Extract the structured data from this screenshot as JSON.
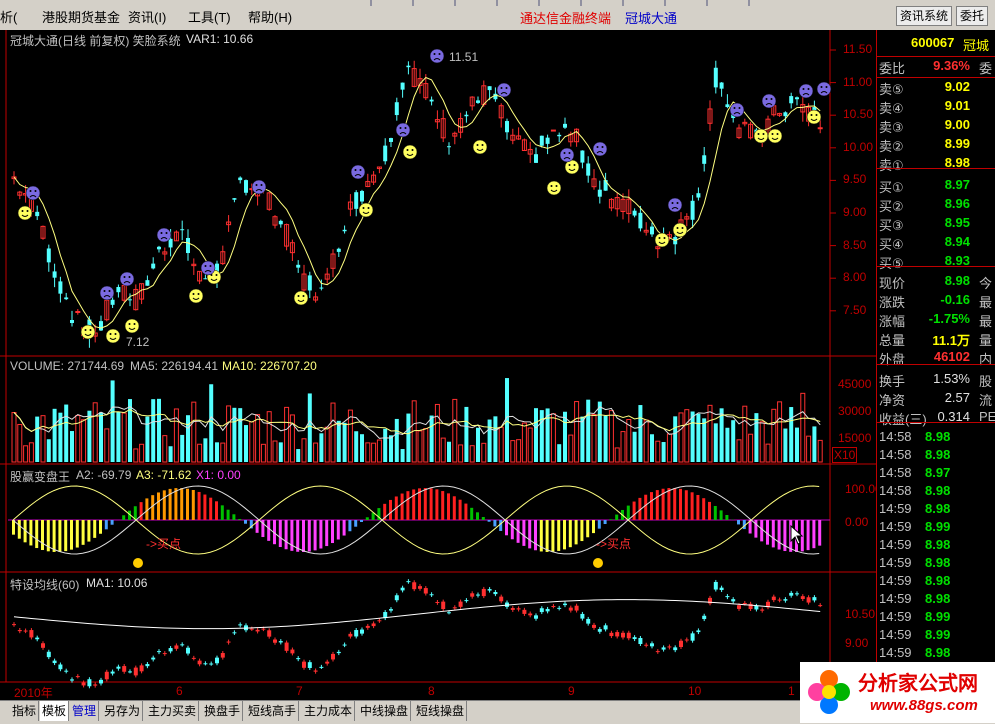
{
  "menu": {
    "items": [
      "析(",
      "港股期货基金",
      "资讯(I)",
      "工具(T)",
      "帮助(H)"
    ],
    "brand_red": "通达信金融终端",
    "brand_blue": "冠城大通",
    "btn_info": "资讯系统",
    "btn_trade": "委托"
  },
  "main_panel": {
    "title": "冠城大通(日线 前复权) 笑脸系统",
    "var_label": "VAR1: 10.66",
    "high_label": "11.51",
    "low_label": "7.12",
    "yticks": [
      "11.50",
      "11.00",
      "10.50",
      "10.00",
      "9.50",
      "9.00",
      "8.50",
      "8.00",
      "7.50"
    ]
  },
  "volume_panel": {
    "label": "VOLUME: 271744.69",
    "ma5": "MA5: 226194.41",
    "ma10": "MA10: 226707.20",
    "yticks": [
      "45000",
      "30000",
      "15000"
    ],
    "unit": "X10"
  },
  "ind_panel": {
    "name": "股赢变盘王",
    "a2": "A2: -69.79",
    "a3": "A3: -71.62",
    "x1": "X1: 0.00",
    "buy1": "->买点",
    "buy2": "->买点",
    "yticks": [
      "100.00",
      "0.00"
    ]
  },
  "ma_panel": {
    "name": "特设均线(60)",
    "ma1": "MA1: 10.06",
    "yticks": [
      "10.50",
      "9.00"
    ]
  },
  "xaxis": {
    "labels": [
      "2010年",
      "6",
      "7",
      "8",
      "9",
      "10",
      "1"
    ]
  },
  "side": {
    "code": "600067",
    "name": "冠城",
    "webi_label": "委比",
    "webi": "9.36%",
    "webi_cut": "委",
    "sells": [
      {
        "label": "卖⑤",
        "price": "9.02"
      },
      {
        "label": "卖④",
        "price": "9.01"
      },
      {
        "label": "卖③",
        "price": "9.00"
      },
      {
        "label": "卖②",
        "price": "8.99"
      },
      {
        "label": "卖①",
        "price": "8.98"
      }
    ],
    "buys": [
      {
        "label": "买①",
        "price": "8.97"
      },
      {
        "label": "买②",
        "price": "8.96"
      },
      {
        "label": "买③",
        "price": "8.95"
      },
      {
        "label": "买④",
        "price": "8.94"
      },
      {
        "label": "买⑤",
        "price": "8.93"
      }
    ],
    "stats": [
      {
        "label": "现价",
        "value": "8.98",
        "cut": "今",
        "color": "#00e000"
      },
      {
        "label": "涨跌",
        "value": "-0.16",
        "cut": "最",
        "color": "#00e000"
      },
      {
        "label": "涨幅",
        "value": "-1.75%",
        "cut": "最",
        "color": "#00e000"
      },
      {
        "label": "总量",
        "value": "11.1万",
        "cut": "量",
        "color": "#ffff00"
      },
      {
        "label": "外盘",
        "value": "46102",
        "cut": "内",
        "color": "#ff3030"
      }
    ],
    "fin": [
      {
        "label": "换手",
        "value": "1.53%",
        "cut": "股"
      },
      {
        "label": "净资",
        "value": "2.57",
        "cut": "流"
      },
      {
        "label": "收益(三)",
        "value": "0.314",
        "cut": "PE"
      }
    ],
    "ticks": [
      {
        "time": "14:58",
        "price": "8.98"
      },
      {
        "time": "14:58",
        "price": "8.98"
      },
      {
        "time": "14:58",
        "price": "8.97"
      },
      {
        "time": "14:58",
        "price": "8.98"
      },
      {
        "time": "14:59",
        "price": "8.98"
      },
      {
        "time": "14:59",
        "price": "8.99"
      },
      {
        "time": "14:59",
        "price": "8.98"
      },
      {
        "time": "14:59",
        "price": "8.98"
      },
      {
        "time": "14:59",
        "price": "8.98"
      },
      {
        "time": "14:59",
        "price": "8.98"
      },
      {
        "time": "14:59",
        "price": "8.99"
      },
      {
        "time": "14:59",
        "price": "8.99"
      },
      {
        "time": "14:59",
        "price": "8.98"
      },
      {
        "time": "14:59",
        "price": "8.98"
      }
    ]
  },
  "tabs": [
    "指标",
    "模板",
    "管理",
    "另存为",
    "主力买卖",
    "换盘手",
    "短线高手",
    "主力成本",
    "中线操盘",
    "短线操盘"
  ],
  "logo": {
    "main": "分析家公式网",
    "url": "www.88gs.com"
  },
  "colors": {
    "up": "#ff3030",
    "down": "#54ffff",
    "ma": "#ffff80",
    "axis": "#c00000"
  }
}
